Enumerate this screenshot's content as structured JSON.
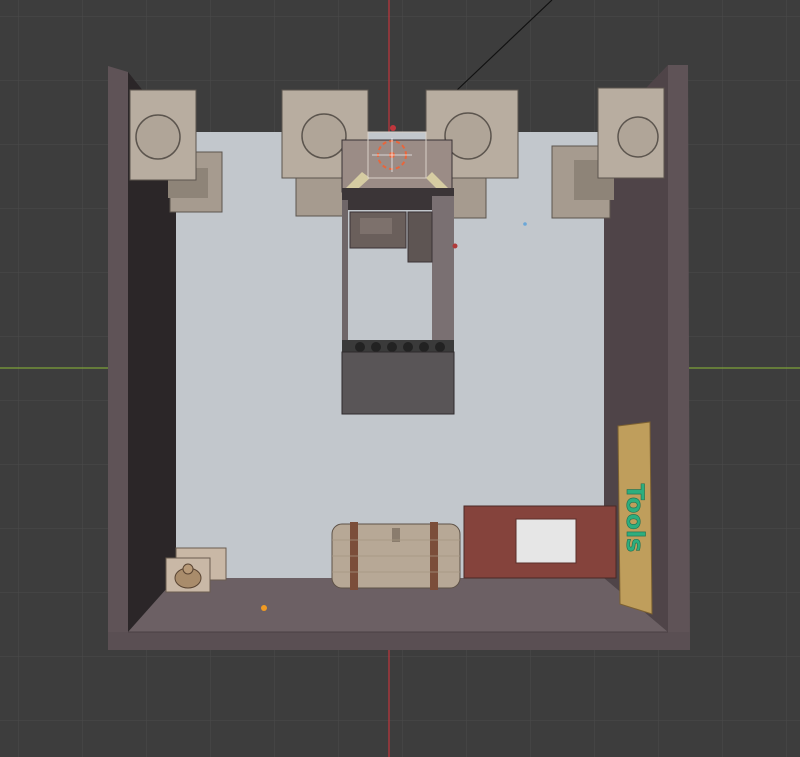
{
  "viewport": {
    "mode": "3d-viewport-orthographic-top",
    "background_color": "#3d3d3d",
    "grid_color": "#4a4a4a",
    "x_axis_color": "#7ea33a",
    "y_axis_color": "#c0363c"
  },
  "scene": {
    "sign_text": "Tools",
    "colors": {
      "wall": "#5f5357",
      "wall_dark": "#2b2628",
      "floor": "#c2c7cc",
      "pillar": "#b8ada0",
      "pillar_dark": "#8e8478",
      "sign_board": "#bf9e5c",
      "sign_letters": "#2dae7e",
      "red_panel": "#85433c",
      "barrel": "#b7a896",
      "barrel_band": "#7b4e3a",
      "selection_origin": "#e8663c"
    }
  }
}
